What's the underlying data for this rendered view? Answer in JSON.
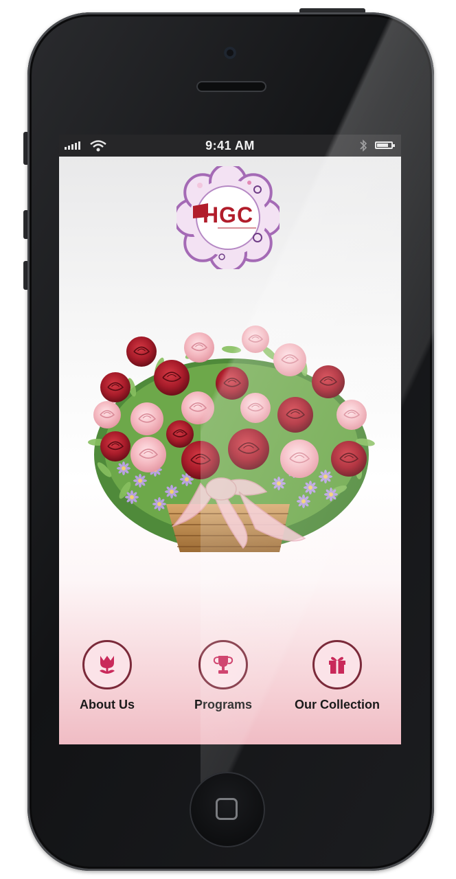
{
  "status_bar": {
    "time": "9:41 AM",
    "signal_bars": 5,
    "battery_level": 0.9
  },
  "app": {
    "logo": {
      "text": "HGC"
    },
    "hero": {
      "subject": "rose-basket-illustration"
    },
    "nav": [
      {
        "label": "About Us",
        "icon": "tulip-icon"
      },
      {
        "label": "Programs",
        "icon": "trophy-icon"
      },
      {
        "label": "Our Collection",
        "icon": "gift-icon"
      }
    ]
  },
  "colors": {
    "accent": "#7b2a3a",
    "icon_fill": "#c9295a",
    "logo_purple": "#a46ab5",
    "logo_red": "#b11d2b",
    "rose_red": "#a81c2a",
    "rose_pink": "#f4b8c0"
  }
}
